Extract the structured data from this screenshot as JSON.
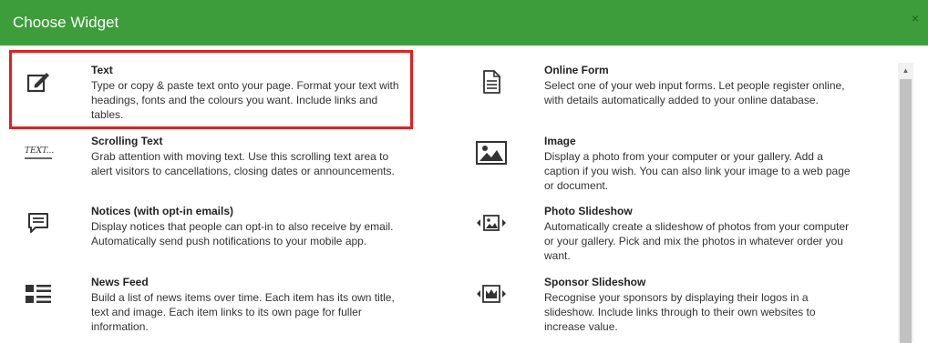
{
  "dialog": {
    "title": "Choose Widget",
    "close_symbol": "×"
  },
  "widgets_left": [
    {
      "icon": "edit-text-icon",
      "title": "Text",
      "description": "Type or copy & paste text onto your page. Format your text with headings, fonts and the colours you want. Include links and tables.",
      "selected": true
    },
    {
      "icon": "scrolling-text-icon",
      "icon_text": "TEXT...",
      "title": "Scrolling Text",
      "description": "Grab attention with moving text. Use this scrolling text area to alert visitors to cancellations, closing dates or announcements."
    },
    {
      "icon": "notice-message-icon",
      "title": "Notices (with opt-in emails)",
      "description": "Display notices that people can opt-in to also receive by email. Automatically send push notifications to your mobile app."
    },
    {
      "icon": "news-list-icon",
      "title": "News Feed",
      "description": "Build a list of news items over time. Each item has its own title, text and image. Each item links to its own page for fuller information."
    }
  ],
  "widgets_right": [
    {
      "icon": "document-form-icon",
      "title": "Online Form",
      "description": "Select one of your web input forms. Let people register online, with details automatically added to your online database."
    },
    {
      "icon": "image-icon",
      "title": "Image",
      "description": "Display a photo from your computer or your gallery. Add a caption if you wish. You can also link your image to a web page or document."
    },
    {
      "icon": "photo-slideshow-icon",
      "title": "Photo Slideshow",
      "description": "Automatically create a slideshow of photos from your computer or your gallery. Pick and mix the photos in whatever order you want."
    },
    {
      "icon": "sponsor-crown-icon",
      "title": "Sponsor Slideshow",
      "description": "Recognise your sponsors by displaying their logos in a slideshow. Include links through to their own websites to increase value."
    }
  ],
  "colors": {
    "header_bg": "#3d9d3a",
    "selection_border": "#e02020"
  }
}
